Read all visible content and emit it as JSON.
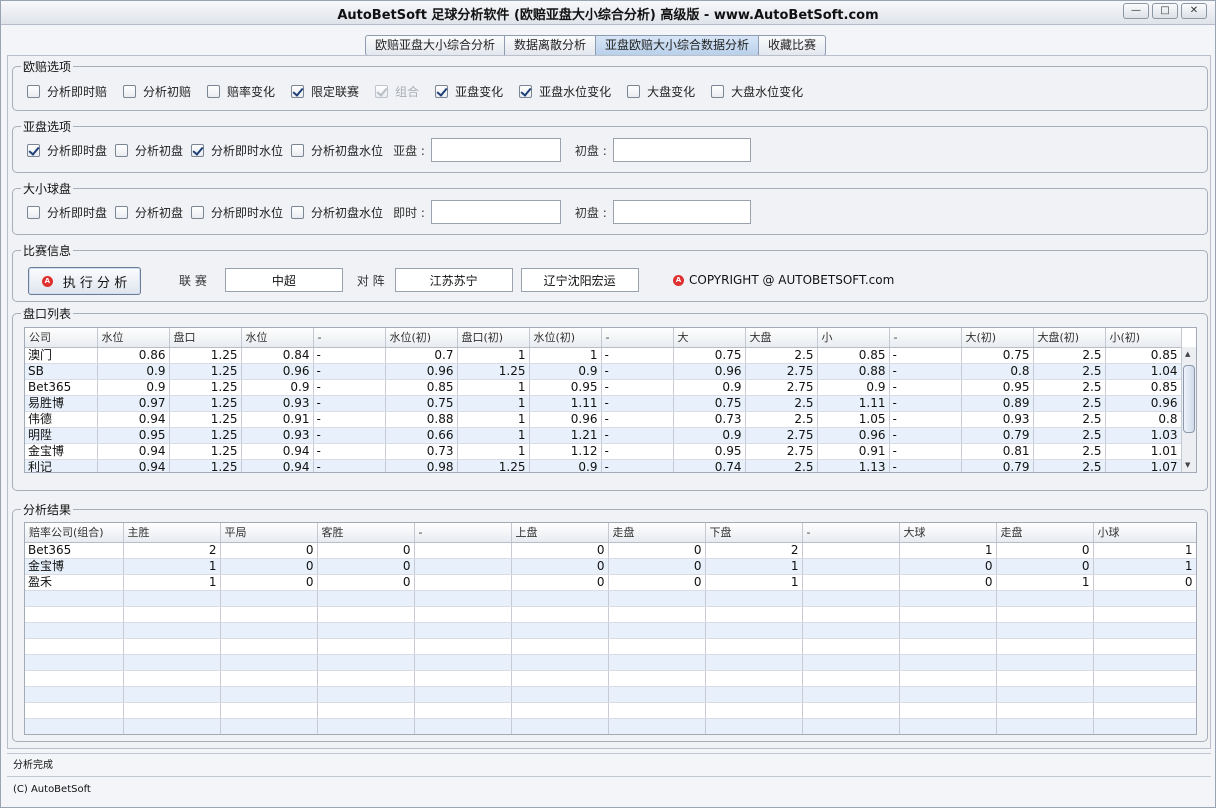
{
  "window": {
    "title": "AutoBetSoft 足球分析软件 (欧赔亚盘大小综合分析) 高级版    - www.AutoBetSoft.com"
  },
  "tabs": [
    {
      "label": "欧赔亚盘大小综合分析"
    },
    {
      "label": "数据离散分析"
    },
    {
      "label": "亚盘欧赔大小综合数据分析"
    },
    {
      "label": "收藏比赛"
    }
  ],
  "euro_options": {
    "title": "欧赔选项",
    "items": [
      {
        "label": "分析即时赔",
        "checked": false
      },
      {
        "label": "分析初赔",
        "checked": false
      },
      {
        "label": "赔率变化",
        "checked": false
      },
      {
        "label": "限定联赛",
        "checked": true
      },
      {
        "label": "组合",
        "checked": true,
        "disabled": true
      },
      {
        "label": "亚盘变化",
        "checked": true
      },
      {
        "label": "亚盘水位变化",
        "checked": true
      },
      {
        "label": "大盘变化",
        "checked": false
      },
      {
        "label": "大盘水位变化",
        "checked": false
      }
    ]
  },
  "asian_options": {
    "title": "亚盘选项",
    "items": [
      {
        "label": "分析即时盘",
        "checked": true
      },
      {
        "label": "分析初盘",
        "checked": false
      },
      {
        "label": "分析即时水位",
        "checked": true
      },
      {
        "label": "分析初盘水位",
        "checked": false
      }
    ],
    "field1_label": "亚盘 :",
    "field1_value": "",
    "field2_label": "初盘 :",
    "field2_value": ""
  },
  "ou_options": {
    "title": "大小球盘",
    "items": [
      {
        "label": "分析即时盘",
        "checked": false
      },
      {
        "label": "分析初盘",
        "checked": false
      },
      {
        "label": "分析即时水位",
        "checked": false
      },
      {
        "label": "分析初盘水位",
        "checked": false
      }
    ],
    "field1_label": "即时 :",
    "field1_value": "",
    "field2_label": "初盘 :",
    "field2_value": ""
  },
  "match_info": {
    "title": "比赛信息",
    "run_button": "执 行 分 析",
    "league_label": "联 赛",
    "league_value": "中超",
    "vs_label": "对 阵",
    "home_team": "江苏苏宁",
    "away_team": "辽宁沈阳宏运",
    "copyright": "COPYRIGHT @ AUTOBETSOFT.com"
  },
  "odds_list": {
    "title": "盘口列表",
    "columns": [
      "公司",
      "水位",
      "盘口",
      "水位",
      "-",
      "水位(初)",
      "盘口(初)",
      "水位(初)",
      "-",
      "大",
      "大盘",
      "小",
      "-",
      "大(初)",
      "大盘(初)",
      "小(初)"
    ],
    "rows": [
      [
        "澳门",
        "0.86",
        "1.25",
        "0.84",
        "-",
        "0.7",
        "1",
        "1",
        "-",
        "0.75",
        "2.5",
        "0.85",
        "-",
        "0.75",
        "2.5",
        "0.85"
      ],
      [
        "SB",
        "0.9",
        "1.25",
        "0.96",
        "-",
        "0.96",
        "1.25",
        "0.9",
        "-",
        "0.96",
        "2.75",
        "0.88",
        "-",
        "0.8",
        "2.5",
        "1.04"
      ],
      [
        "Bet365",
        "0.9",
        "1.25",
        "0.9",
        "-",
        "0.85",
        "1",
        "0.95",
        "-",
        "0.9",
        "2.75",
        "0.9",
        "-",
        "0.95",
        "2.5",
        "0.85"
      ],
      [
        "易胜博",
        "0.97",
        "1.25",
        "0.93",
        "-",
        "0.75",
        "1",
        "1.11",
        "-",
        "0.75",
        "2.5",
        "1.11",
        "-",
        "0.89",
        "2.5",
        "0.96"
      ],
      [
        "伟德",
        "0.94",
        "1.25",
        "0.91",
        "-",
        "0.88",
        "1",
        "0.96",
        "-",
        "0.73",
        "2.5",
        "1.05",
        "-",
        "0.93",
        "2.5",
        "0.8"
      ],
      [
        "明陞",
        "0.95",
        "1.25",
        "0.93",
        "-",
        "0.66",
        "1",
        "1.21",
        "-",
        "0.9",
        "2.75",
        "0.96",
        "-",
        "0.79",
        "2.5",
        "1.03"
      ],
      [
        "金宝博",
        "0.94",
        "1.25",
        "0.94",
        "-",
        "0.73",
        "1",
        "1.12",
        "-",
        "0.95",
        "2.75",
        "0.91",
        "-",
        "0.81",
        "2.5",
        "1.01"
      ],
      [
        "利记",
        "0.94",
        "1.25",
        "0.94",
        "-",
        "0.98",
        "1.25",
        "0.9",
        "-",
        "0.74",
        "2.5",
        "1.13",
        "-",
        "0.79",
        "2.5",
        "1.07"
      ]
    ]
  },
  "results": {
    "title": "分析结果",
    "columns": [
      "赔率公司(组合)",
      "主胜",
      "平局",
      "客胜",
      "-",
      "上盘",
      "走盘",
      "下盘",
      "-",
      "大球",
      "走盘",
      "小球"
    ],
    "rows": [
      [
        "Bet365",
        "2",
        "0",
        "0",
        "",
        "0",
        "0",
        "2",
        "",
        "1",
        "0",
        "1"
      ],
      [
        "金宝博",
        "1",
        "0",
        "0",
        "",
        "0",
        "0",
        "1",
        "",
        "0",
        "0",
        "1"
      ],
      [
        "盈禾",
        "1",
        "0",
        "0",
        "",
        "0",
        "0",
        "1",
        "",
        "0",
        "1",
        "0"
      ]
    ],
    "empty_rows": 10
  },
  "status": {
    "text": "分析完成"
  },
  "footer": {
    "text": "(C) AutoBetSoft"
  },
  "icons": {
    "min": "minimize-icon",
    "max": "maximize-icon",
    "close": "close-icon",
    "run": "run-icon"
  },
  "colors": {
    "active_tab": "#c6dbf1",
    "alt_row": "#e8f1fb",
    "icon_red": "#e03131"
  }
}
